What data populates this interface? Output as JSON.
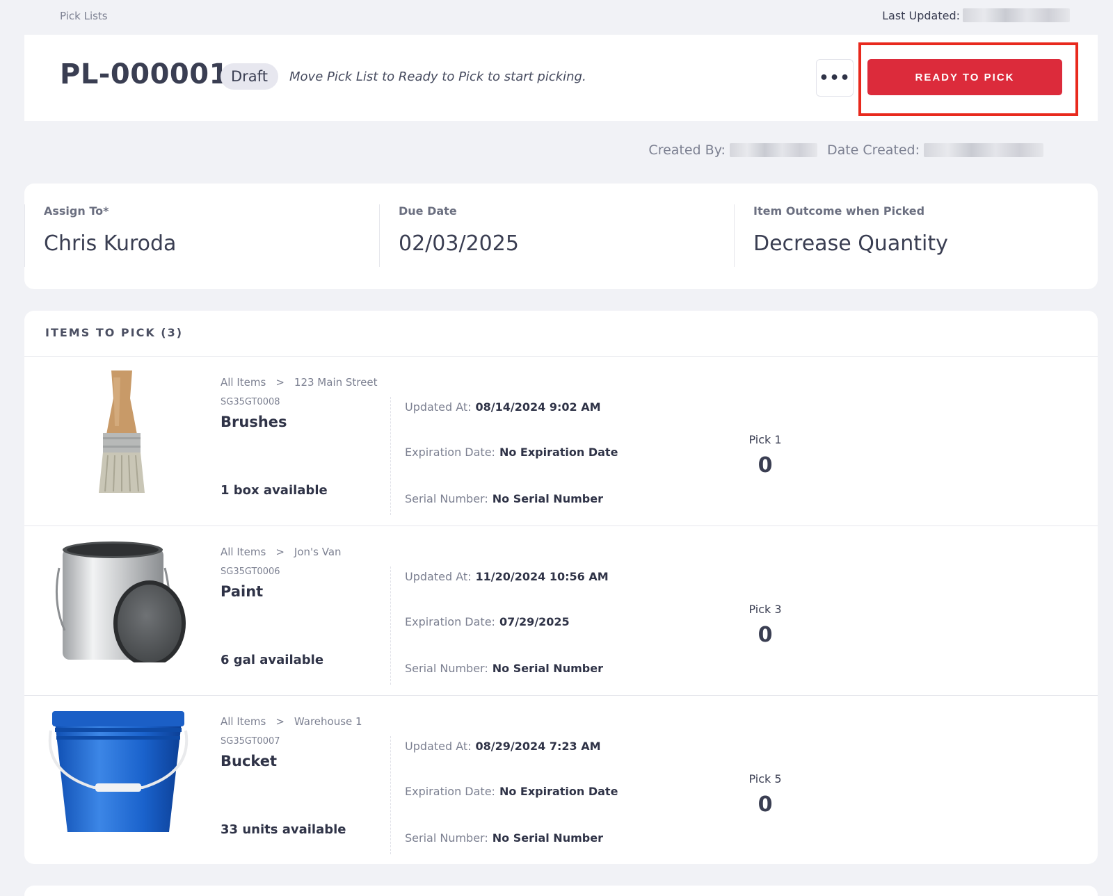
{
  "breadcrumb": "Pick Lists",
  "last_updated_label": "Last Updated:",
  "header": {
    "title": "PL-000001",
    "status": "Draft",
    "hint": "Move Pick List to Ready to Pick to start picking.",
    "more_label": "•••",
    "ready_label": "READY TO PICK"
  },
  "meta": {
    "created_by_label": "Created By:",
    "date_created_label": "Date Created:"
  },
  "info": {
    "assign_label": "Assign To*",
    "assign_value": "Chris Kuroda",
    "due_label": "Due Date",
    "due_value": "02/03/2025",
    "outcome_label": "Item Outcome when Picked",
    "outcome_value": "Decrease Quantity"
  },
  "items_header": "ITEMS TO PICK (3)",
  "labels": {
    "updated_at": "Updated At:",
    "expiration": "Expiration Date:",
    "serial": "Serial Number:",
    "all_items": "All Items",
    "sep": ">"
  },
  "items": [
    {
      "location": "123 Main Street",
      "sku": "SG35GT0008",
      "name": "Brushes",
      "available": "1 box available",
      "updated_at": "08/14/2024 9:02 AM",
      "expiration": "No Expiration Date",
      "serial": "No Serial Number",
      "pick_label": "Pick 1",
      "pick_value": "0",
      "image": "paint-brush"
    },
    {
      "location": "Jon's Van",
      "sku": "SG35GT0006",
      "name": "Paint",
      "available": "6 gal available",
      "updated_at": "11/20/2024 10:56 AM",
      "expiration": "07/29/2025",
      "serial": "No Serial Number",
      "pick_label": "Pick 3",
      "pick_value": "0",
      "image": "paint-can"
    },
    {
      "location": "Warehouse 1",
      "sku": "SG35GT0007",
      "name": "Bucket",
      "available": "33 units available",
      "updated_at": "08/29/2024 7:23 AM",
      "expiration": "No Expiration Date",
      "serial": "No Serial Number",
      "pick_label": "Pick 5",
      "pick_value": "0",
      "image": "blue-bucket"
    }
  ],
  "colors": {
    "accent": "#dc2b3b",
    "highlight": "#e8291d",
    "background": "#f1f2f6"
  }
}
